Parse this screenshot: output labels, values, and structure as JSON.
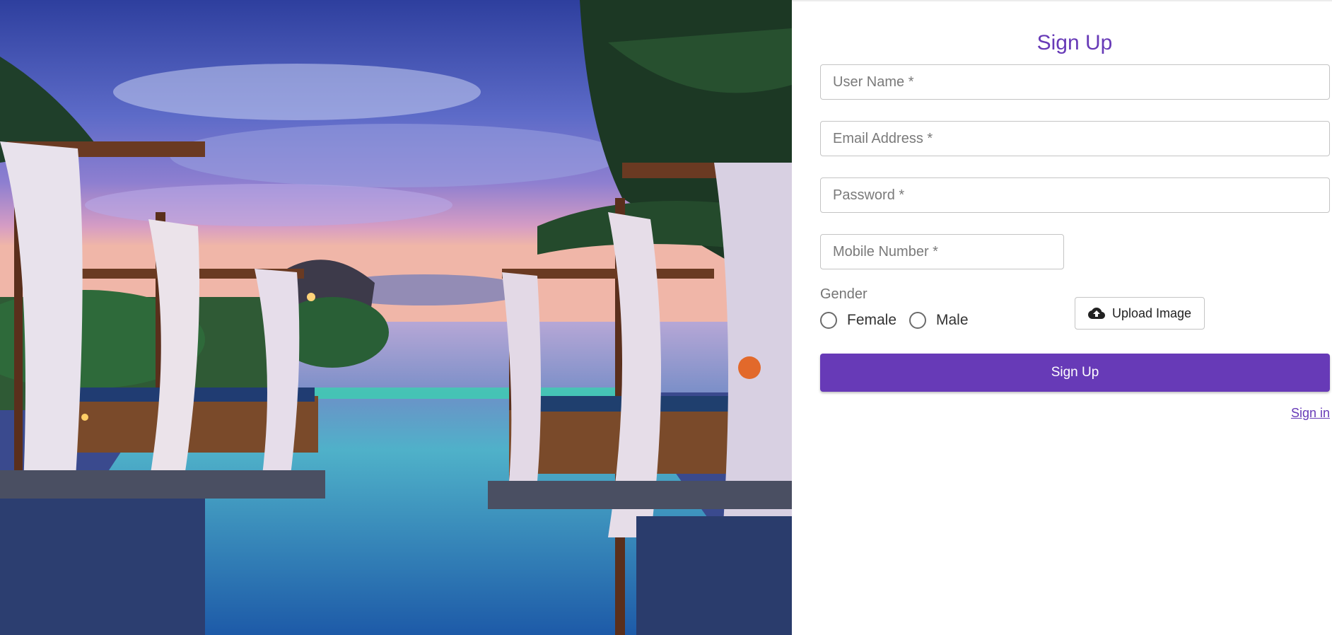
{
  "hero": {
    "image_icon": "resort-pool-photo"
  },
  "form": {
    "title": "Sign Up",
    "fields": {
      "username_placeholder": "User Name *",
      "email_placeholder": "Email Address *",
      "password_placeholder": "Password *",
      "mobile_placeholder": "Mobile Number *"
    },
    "gender": {
      "label": "Gender",
      "options": [
        "Female",
        "Male"
      ],
      "selected": null
    },
    "upload": {
      "icon": "cloud-upload-icon",
      "label": "Upload Image"
    },
    "submit_label": "Sign Up",
    "signin_link": "Sign in"
  },
  "colors": {
    "primary": "#673ab7",
    "border": "#c4c4c4",
    "placeholder": "#7a7a7a"
  }
}
